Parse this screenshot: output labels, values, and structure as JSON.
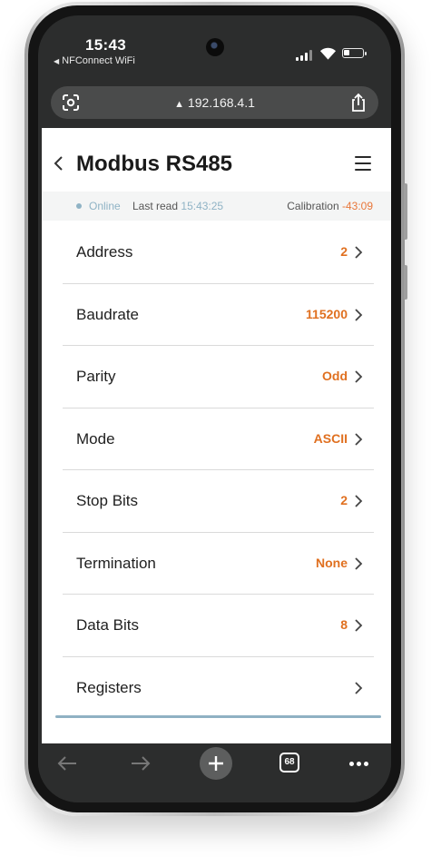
{
  "status_bar": {
    "time": "15:43",
    "back_app": "NFConnect WiFi"
  },
  "browser": {
    "url": "192.168.4.1",
    "tab_count": "68"
  },
  "header": {
    "title": "Modbus RS485"
  },
  "info": {
    "online": "Online",
    "last_read_label": "Last read",
    "last_read_value": "15:43:25",
    "calibration_label": "Calibration",
    "calibration_value": "-43:09"
  },
  "settings": [
    {
      "label": "Address",
      "value": "2"
    },
    {
      "label": "Baudrate",
      "value": "115200"
    },
    {
      "label": "Parity",
      "value": "Odd"
    },
    {
      "label": "Mode",
      "value": "ASCII"
    },
    {
      "label": "Stop Bits",
      "value": "2"
    },
    {
      "label": "Termination",
      "value": "None"
    },
    {
      "label": "Data Bits",
      "value": "8"
    },
    {
      "label": "Registers",
      "value": ""
    }
  ],
  "colors": {
    "accent": "#e07020",
    "online": "#8fb3c5",
    "progress": "#8fb1c3"
  },
  "icons": {
    "back": "chevron-left-icon",
    "menu": "hamburger-menu-icon",
    "row_arrow": "chevron-right-icon",
    "lens": "google-lens-icon",
    "share": "share-icon",
    "nav_back": "arrow-left-icon",
    "nav_forward": "arrow-right-icon",
    "new_tab": "plus-icon",
    "tabs": "tabs-icon",
    "more": "more-dots-icon"
  }
}
